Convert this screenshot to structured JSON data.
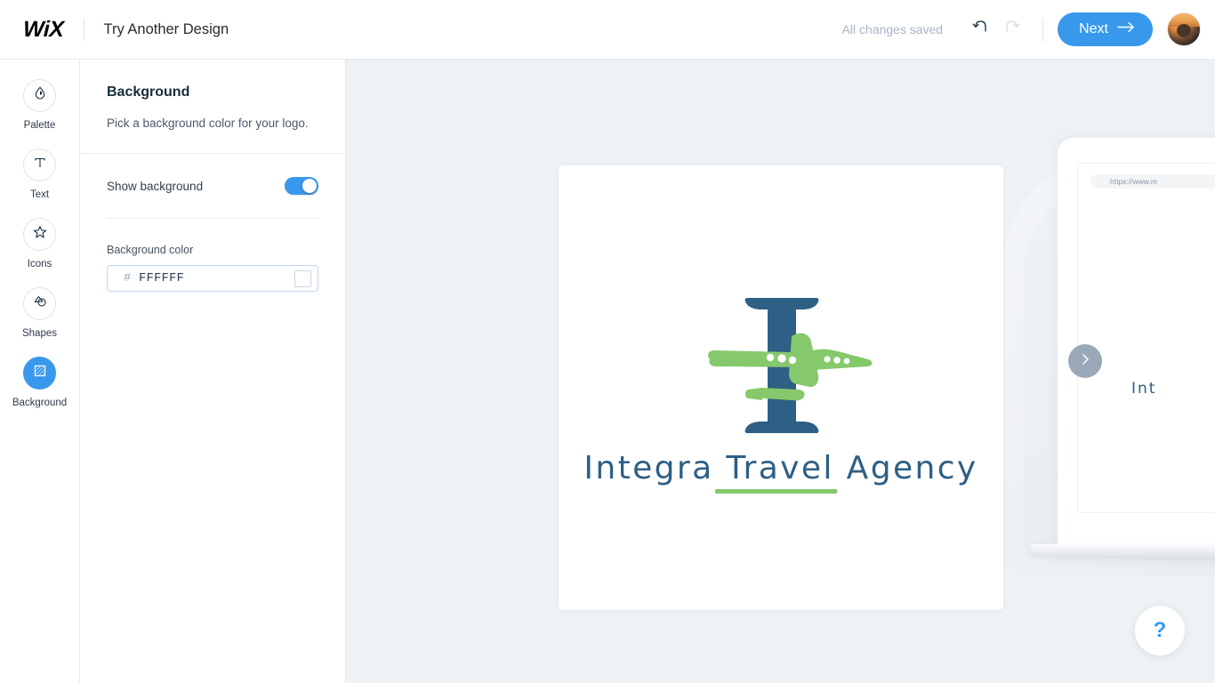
{
  "header": {
    "brand": "WiX",
    "title": "Try Another Design",
    "save_status": "All changes saved",
    "undo_icon": "undo-icon",
    "redo_icon": "redo-icon",
    "next_label": "Next",
    "next_arrow": "→",
    "avatar_icon": "user-avatar",
    "accent_color": "#3899ec"
  },
  "sidebar": {
    "items": [
      {
        "label": "Palette",
        "icon": "droplet-icon",
        "active": false
      },
      {
        "label": "Text",
        "icon": "text-t-icon",
        "active": false
      },
      {
        "label": "Icons",
        "icon": "star-icon",
        "active": false
      },
      {
        "label": "Shapes",
        "icon": "shapes-icon",
        "active": false
      },
      {
        "label": "Background",
        "icon": "background-icon",
        "active": true
      }
    ]
  },
  "panel": {
    "title": "Background",
    "subtitle": "Pick a background color for your logo.",
    "toggle_label": "Show background",
    "toggle_on": true,
    "color_label": "Background color",
    "color_hash": "#",
    "color_value": "FFFFFF",
    "swatch_color": "#FFFFFF",
    "swatch_icon": "color-swatch"
  },
  "canvas": {
    "background_color": "#eef2f5",
    "logo": {
      "text": "Integra Travel Agency",
      "mark_icon": "letter-i-airplane-logo",
      "letter": "I",
      "letter_color": "#2e5f85",
      "plane_color": "#85c96c",
      "text_color": "#2e5f85",
      "underline_color": "#85c96c",
      "card_color": "#FFFFFF"
    },
    "next_design_icon": "chevron-right-icon",
    "help_icon": "question-mark-icon",
    "help_label": "?"
  },
  "preview": {
    "url": "https://www.m",
    "logo_text": "Int"
  }
}
